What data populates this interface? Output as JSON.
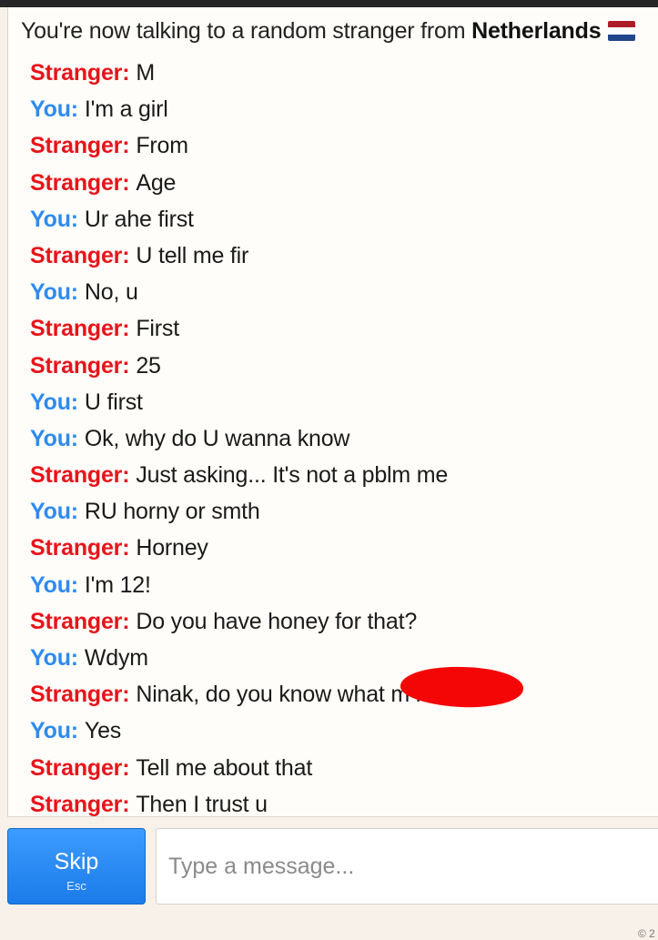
{
  "status": {
    "prefix": "You're now talking to a random stranger from ",
    "country": "Netherlands",
    "flag_colors": [
      "#ae1c28",
      "#ffffff",
      "#21468b"
    ]
  },
  "colors": {
    "stranger": "#e6141b",
    "you": "#2f8bef",
    "skip_button": "#1b7be9",
    "redaction": "#f50606"
  },
  "messages": [
    {
      "sender": "Stranger:",
      "text": "M"
    },
    {
      "sender": "You:",
      "text": "I'm a girl"
    },
    {
      "sender": "Stranger:",
      "text": "From"
    },
    {
      "sender": "Stranger:",
      "text": "Age"
    },
    {
      "sender": "You:",
      "text": "Ur ahe first"
    },
    {
      "sender": "Stranger:",
      "text": "U tell me fir"
    },
    {
      "sender": "You:",
      "text": "No, u"
    },
    {
      "sender": "Stranger:",
      "text": "First"
    },
    {
      "sender": "Stranger:",
      "text": "25"
    },
    {
      "sender": "You:",
      "text": "U first"
    },
    {
      "sender": "You:",
      "text": "Ok, why do U wanna know"
    },
    {
      "sender": "Stranger:",
      "text": "Just asking... It's not a pblm me"
    },
    {
      "sender": "You:",
      "text": "RU horny or smth"
    },
    {
      "sender": "Stranger:",
      "text": "Horney"
    },
    {
      "sender": "You:",
      "text": "I'm 12!"
    },
    {
      "sender": "Stranger:",
      "text": "Do you have honey for that?"
    },
    {
      "sender": "You:",
      "text": "Wdym"
    },
    {
      "sender": "Stranger:",
      "text": "Ninak, do you know what m                 n is?"
    },
    {
      "sender": "You:",
      "text": "Yes"
    },
    {
      "sender": "Stranger:",
      "text": "Tell me about that"
    },
    {
      "sender": "Stranger:",
      "text": "Then I trust u"
    }
  ],
  "skip": {
    "label": "Skip",
    "key": "Esc"
  },
  "input": {
    "placeholder": "Type a message...",
    "value": ""
  },
  "footer": {
    "copyright": "© 2"
  }
}
